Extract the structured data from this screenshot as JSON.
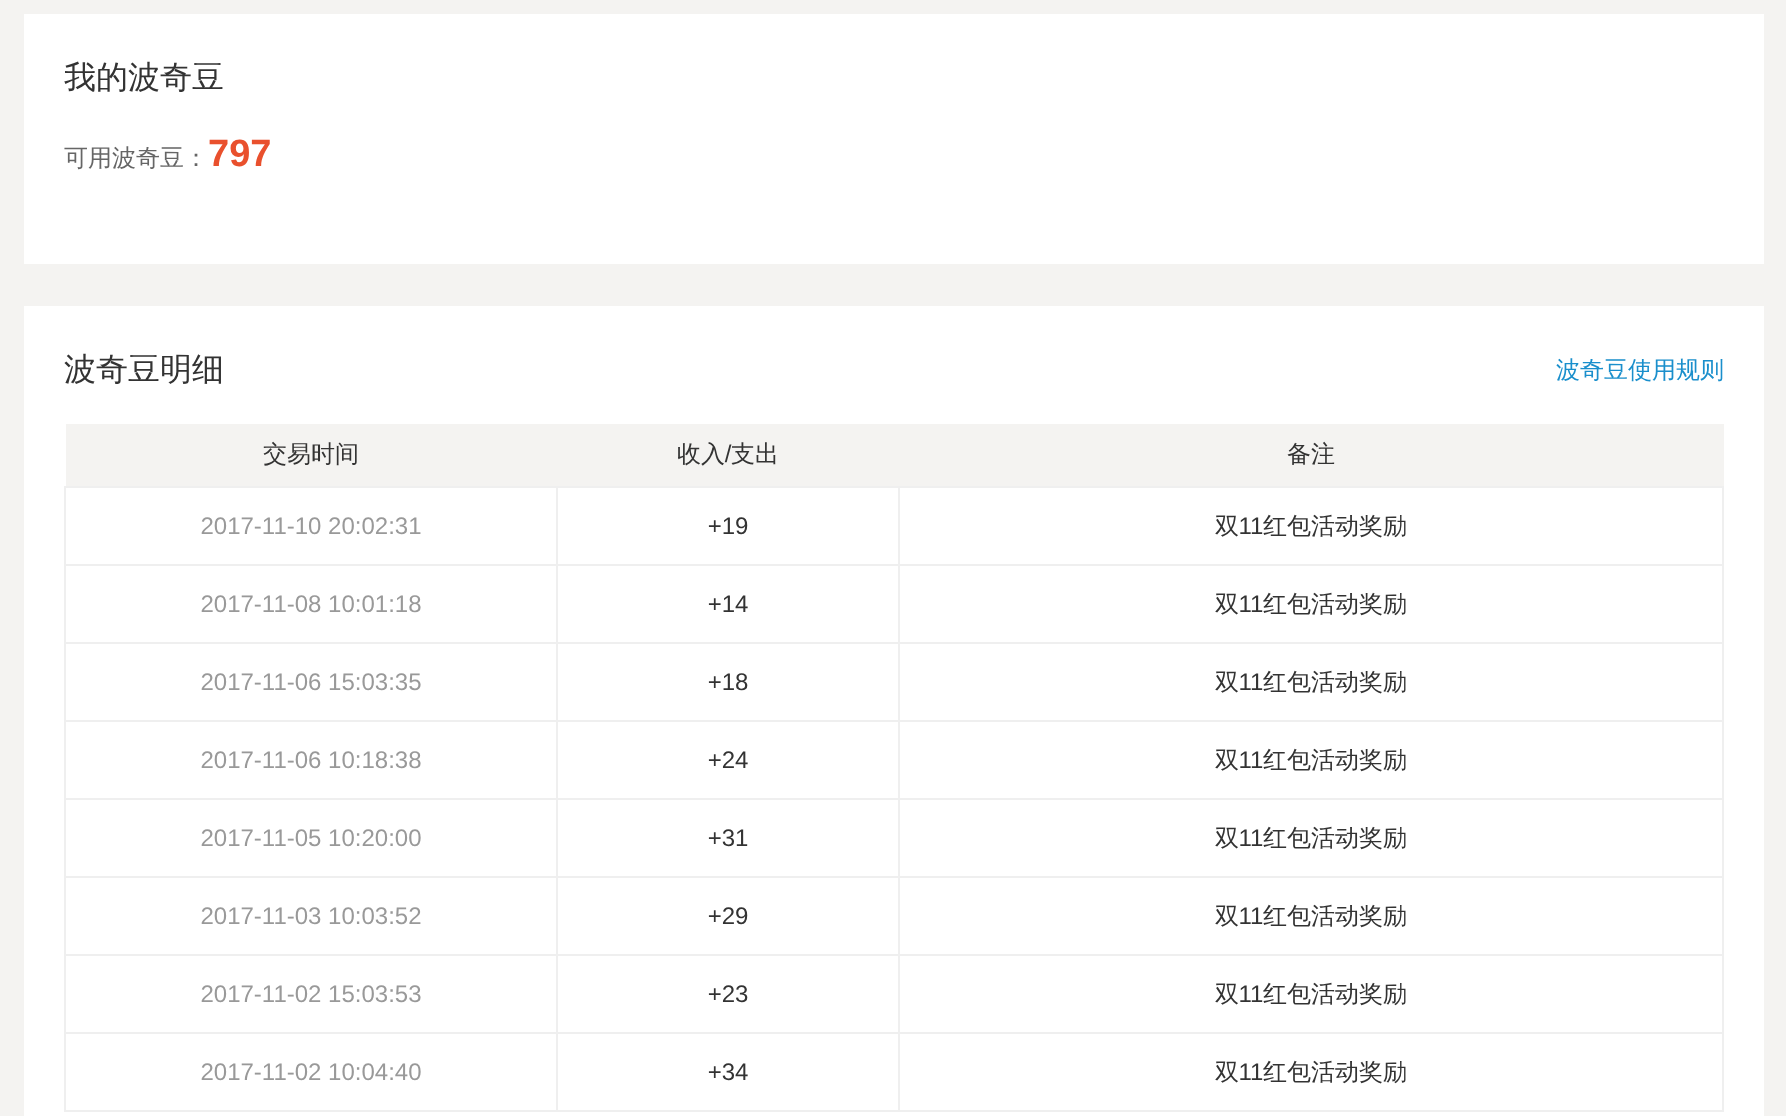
{
  "summary": {
    "title": "我的波奇豆",
    "label": "可用波奇豆：",
    "balance": "797"
  },
  "detail": {
    "title": "波奇豆明细",
    "rules_link": "波奇豆使用规则",
    "columns": [
      "交易时间",
      "收入/支出",
      "备注"
    ],
    "rows": [
      {
        "time": "2017-11-10 20:02:31",
        "amount": "+19",
        "note": "双11红包活动奖励"
      },
      {
        "time": "2017-11-08 10:01:18",
        "amount": "+14",
        "note": "双11红包活动奖励"
      },
      {
        "time": "2017-11-06 15:03:35",
        "amount": "+18",
        "note": "双11红包活动奖励"
      },
      {
        "time": "2017-11-06 10:18:38",
        "amount": "+24",
        "note": "双11红包活动奖励"
      },
      {
        "time": "2017-11-05 10:20:00",
        "amount": "+31",
        "note": "双11红包活动奖励"
      },
      {
        "time": "2017-11-03 10:03:52",
        "amount": "+29",
        "note": "双11红包活动奖励"
      },
      {
        "time": "2017-11-02 15:03:53",
        "amount": "+23",
        "note": "双11红包活动奖励"
      },
      {
        "time": "2017-11-02 10:04:40",
        "amount": "+34",
        "note": "双11红包活动奖励"
      }
    ]
  }
}
